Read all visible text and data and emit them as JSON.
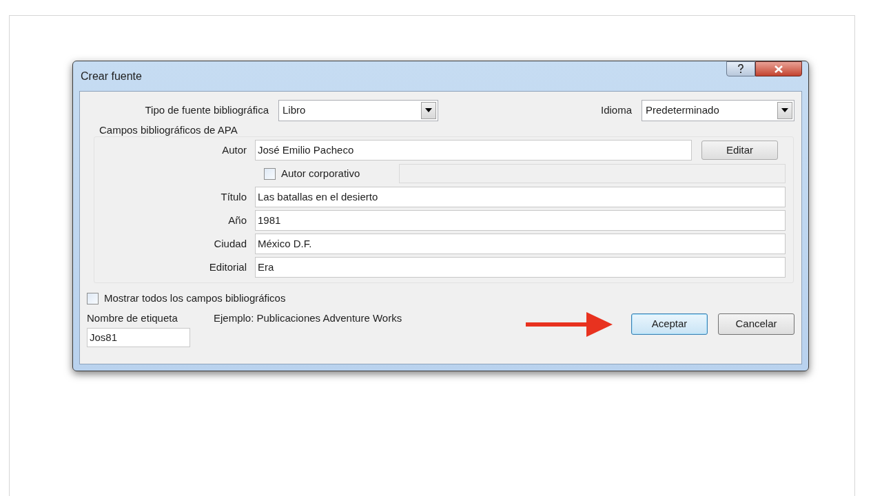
{
  "window": {
    "title": "Crear fuente"
  },
  "source_type": {
    "label": "Tipo de fuente bibliográfica",
    "value": "Libro"
  },
  "language": {
    "label": "Idioma",
    "value": "Predeterminado"
  },
  "group": {
    "title": "Campos bibliográficos de APA",
    "fields": [
      {
        "kind": "text_button",
        "label": "Autor",
        "value": "José Emilio Pacheco",
        "button": "Editar"
      },
      {
        "kind": "checkbox_field",
        "label": "Autor corporativo",
        "checked": false,
        "disabled": true
      },
      {
        "kind": "text",
        "label": "Título",
        "value": "Las batallas en el desierto"
      },
      {
        "kind": "text",
        "label": "Año",
        "value": "1981"
      },
      {
        "kind": "text",
        "label": "Ciudad",
        "value": "México D.F."
      },
      {
        "kind": "text",
        "label": "Editorial",
        "value": "Era"
      }
    ]
  },
  "show_all": {
    "label": "Mostrar todos los campos bibliográficos",
    "checked": false
  },
  "tag": {
    "label": "Nombre de etiqueta",
    "value": "Jos81",
    "example": "Ejemplo: Publicaciones Adventure Works"
  },
  "buttons": [
    {
      "label": "Aceptar",
      "default": true
    },
    {
      "label": "Cancelar",
      "default": false
    }
  ]
}
